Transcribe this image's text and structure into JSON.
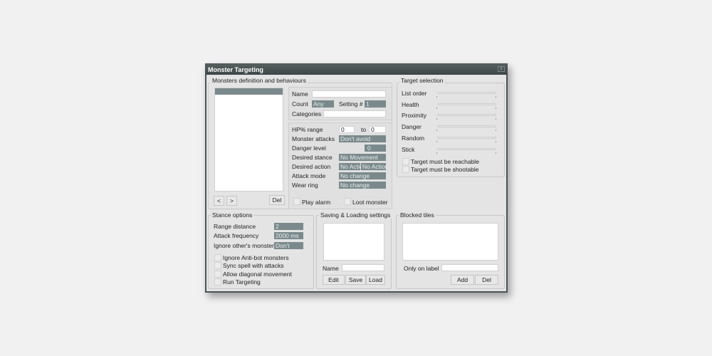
{
  "window": {
    "title": "Monster Targeting",
    "close": "x"
  },
  "monsters": {
    "group_label": "Monsters definition and behaviours",
    "prev": "<",
    "next": ">",
    "del": "Del",
    "name_label": "Name",
    "name_value": "",
    "count_label": "Count",
    "count_value": "Any",
    "setting_label": "Setting #",
    "setting_value": "1",
    "categories_label": "Categories",
    "categories_value": "",
    "hp_label": "HP% range",
    "hp_from": "0",
    "hp_to_label": "to",
    "hp_to": "0",
    "attacks_label": "Monster attacks",
    "attacks_value": "Don't avoid",
    "danger_label": "Danger level",
    "danger_value": "0",
    "stance_label": "Desired stance",
    "stance_value": "No Movement",
    "action_label": "Desired action",
    "action_value1": "No Action",
    "action_value2": "No Action",
    "attack_mode_label": "Attack mode",
    "attack_mode_value": "No change",
    "wear_ring_label": "Wear ring",
    "wear_ring_value": "No change",
    "play_alarm": "Play alarm",
    "loot_monster": "Loot monster"
  },
  "target": {
    "group_label": "Target selection",
    "sliders": [
      "List order",
      "Health",
      "Proximity",
      "Danger",
      "Random",
      "Stick"
    ],
    "reachable": "Target must be reachable",
    "shootable": "Target must be shootable"
  },
  "stance": {
    "group_label": "Stance options",
    "range_label": "Range distance",
    "range_value": "2",
    "freq_label": "Attack frequency",
    "freq_value": "2000 ms",
    "ignore_label": "Ignore other's monsters",
    "ignore_value": "Don't",
    "checks": [
      "Ignore Anti-bot monsters",
      "Sync spell with attacks",
      "Allow diagonal movement",
      "Run Targeting"
    ]
  },
  "saving": {
    "group_label": "Saving & Loading settings",
    "name_label": "Name",
    "name_value": "",
    "edit": "Edit",
    "save": "Save",
    "load": "Load"
  },
  "blocked": {
    "group_label": "Blocked tiles",
    "label_label": "Only on label",
    "label_value": "",
    "add": "Add",
    "del": "Del"
  }
}
